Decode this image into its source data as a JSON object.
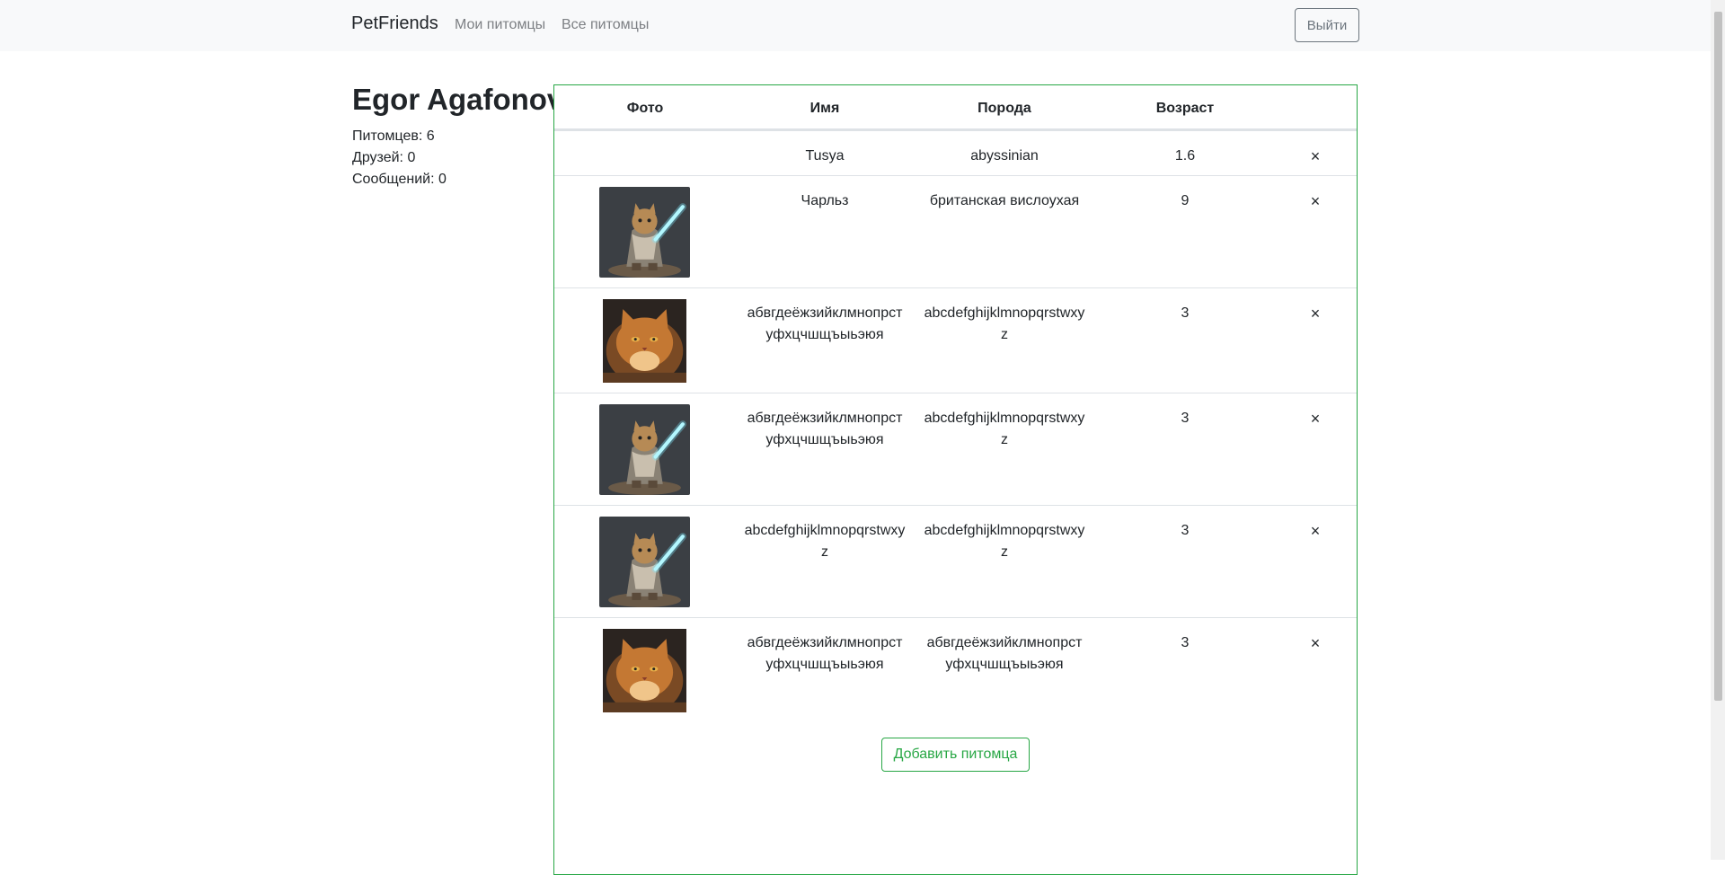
{
  "navbar": {
    "brand": "PetFriends",
    "links": [
      "Мои питомцы",
      "Все питомцы"
    ],
    "logout_label": "Выйти"
  },
  "profile": {
    "name": "Egor Agafonov",
    "pets_count": "Питомцев: 6",
    "friends_count": "Друзей: 0",
    "messages_count": "Сообщений: 0"
  },
  "table": {
    "headers": [
      "Фото",
      "Имя",
      "Порода",
      "Возраст"
    ],
    "rows": [
      {
        "photo": "none",
        "name": "Tusya",
        "breed": "abyssinian",
        "age": "1.6",
        "delete": "×"
      },
      {
        "photo": "jedi-cat",
        "name": "Чарльз",
        "breed": "британская вислоухая",
        "age": "9",
        "delete": "×"
      },
      {
        "photo": "orange-cat",
        "name": "абвгдеёжзийклмнопрстуфхцчшщъыьэюя",
        "breed": "abcdefghijklmnopqrstwxyz",
        "age": "3",
        "delete": "×"
      },
      {
        "photo": "jedi-cat",
        "name": "абвгдеёжзийклмнопрстуфхцчшщъыьэюя",
        "breed": "abcdefghijklmnopqrstwxyz",
        "age": "3",
        "delete": "×"
      },
      {
        "photo": "jedi-cat",
        "name": "abcdefghijklmnopqrstwxyz",
        "breed": "abcdefghijklmnopqrstwxyz",
        "age": "3",
        "delete": "×"
      },
      {
        "photo": "orange-cat",
        "name": "абвгдеёжзийклмнопрстуфхцчшщъыьэюя",
        "breed": "абвгдеёжзийклмнопрстуфхцчшщъыьэюя",
        "age": "3",
        "delete": "×"
      }
    ]
  },
  "add_pet_label": "Добавить питомца",
  "colors": {
    "accent": "#28a745",
    "navbar_bg": "#f8f9fa",
    "nav_link": "#7c7f83",
    "text": "#212529"
  }
}
